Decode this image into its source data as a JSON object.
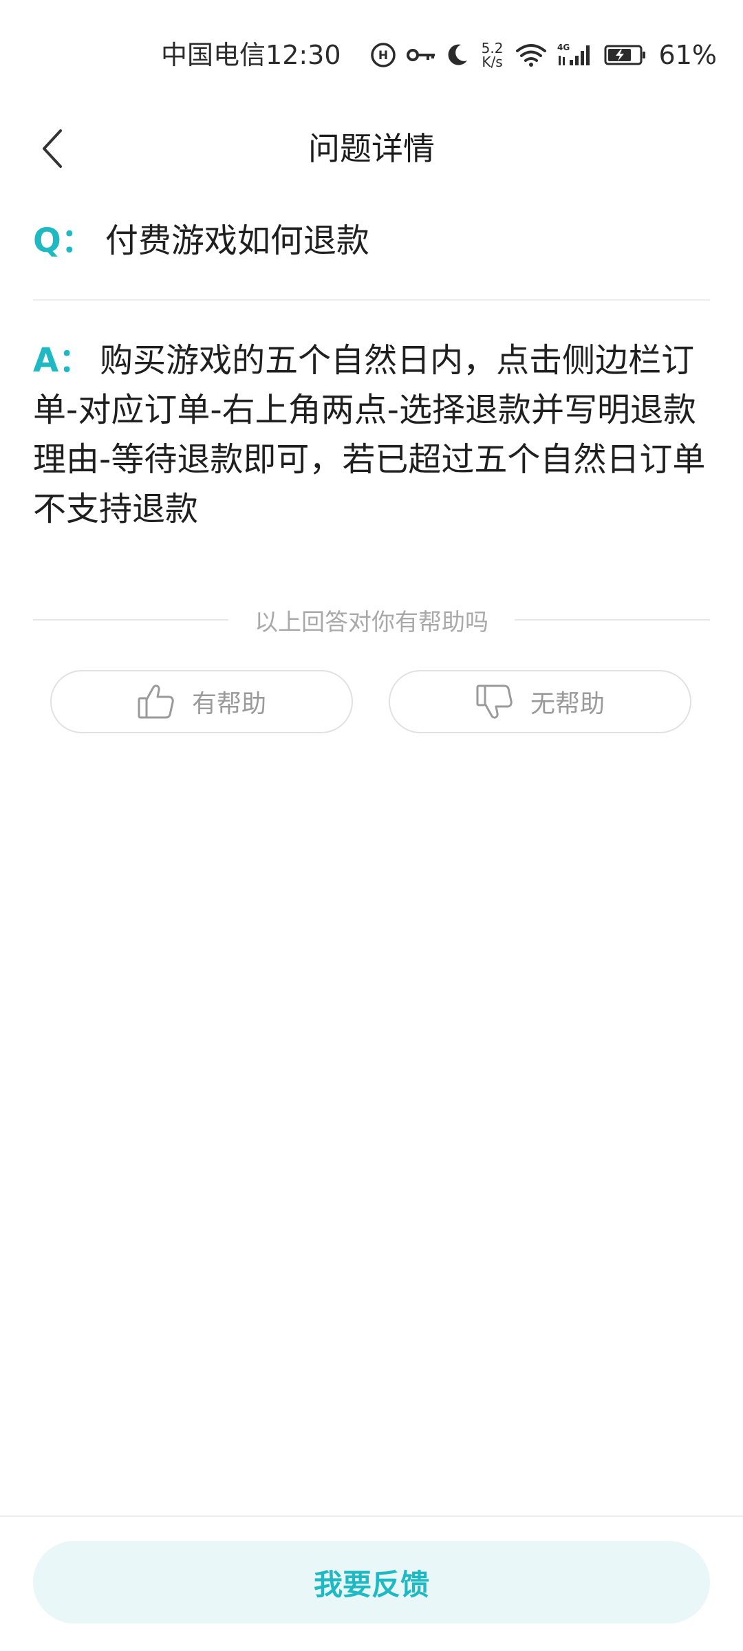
{
  "status_bar": {
    "carrier": "中国电信",
    "time": "12:30",
    "net_speed_value": "5.2",
    "net_speed_unit": "K/s",
    "network_type": "4G",
    "battery_percent": "61%"
  },
  "header": {
    "title": "问题详情"
  },
  "question": {
    "prefix": "Q：",
    "text": "付费游戏如何退款"
  },
  "answer": {
    "prefix": "A：",
    "text": "购买游戏的五个自然日内，点击侧边栏订单-对应订单-右上角两点-选择退款并写明退款理由-等待退款即可，若已超过五个自然日订单不支持退款"
  },
  "helpful": {
    "prompt": "以上回答对你有帮助吗",
    "yes_label": "有帮助",
    "no_label": "无帮助"
  },
  "footer": {
    "feedback_label": "我要反馈"
  },
  "colors": {
    "accent": "#1fb9c4",
    "accent_bg": "#e9f7f8"
  }
}
